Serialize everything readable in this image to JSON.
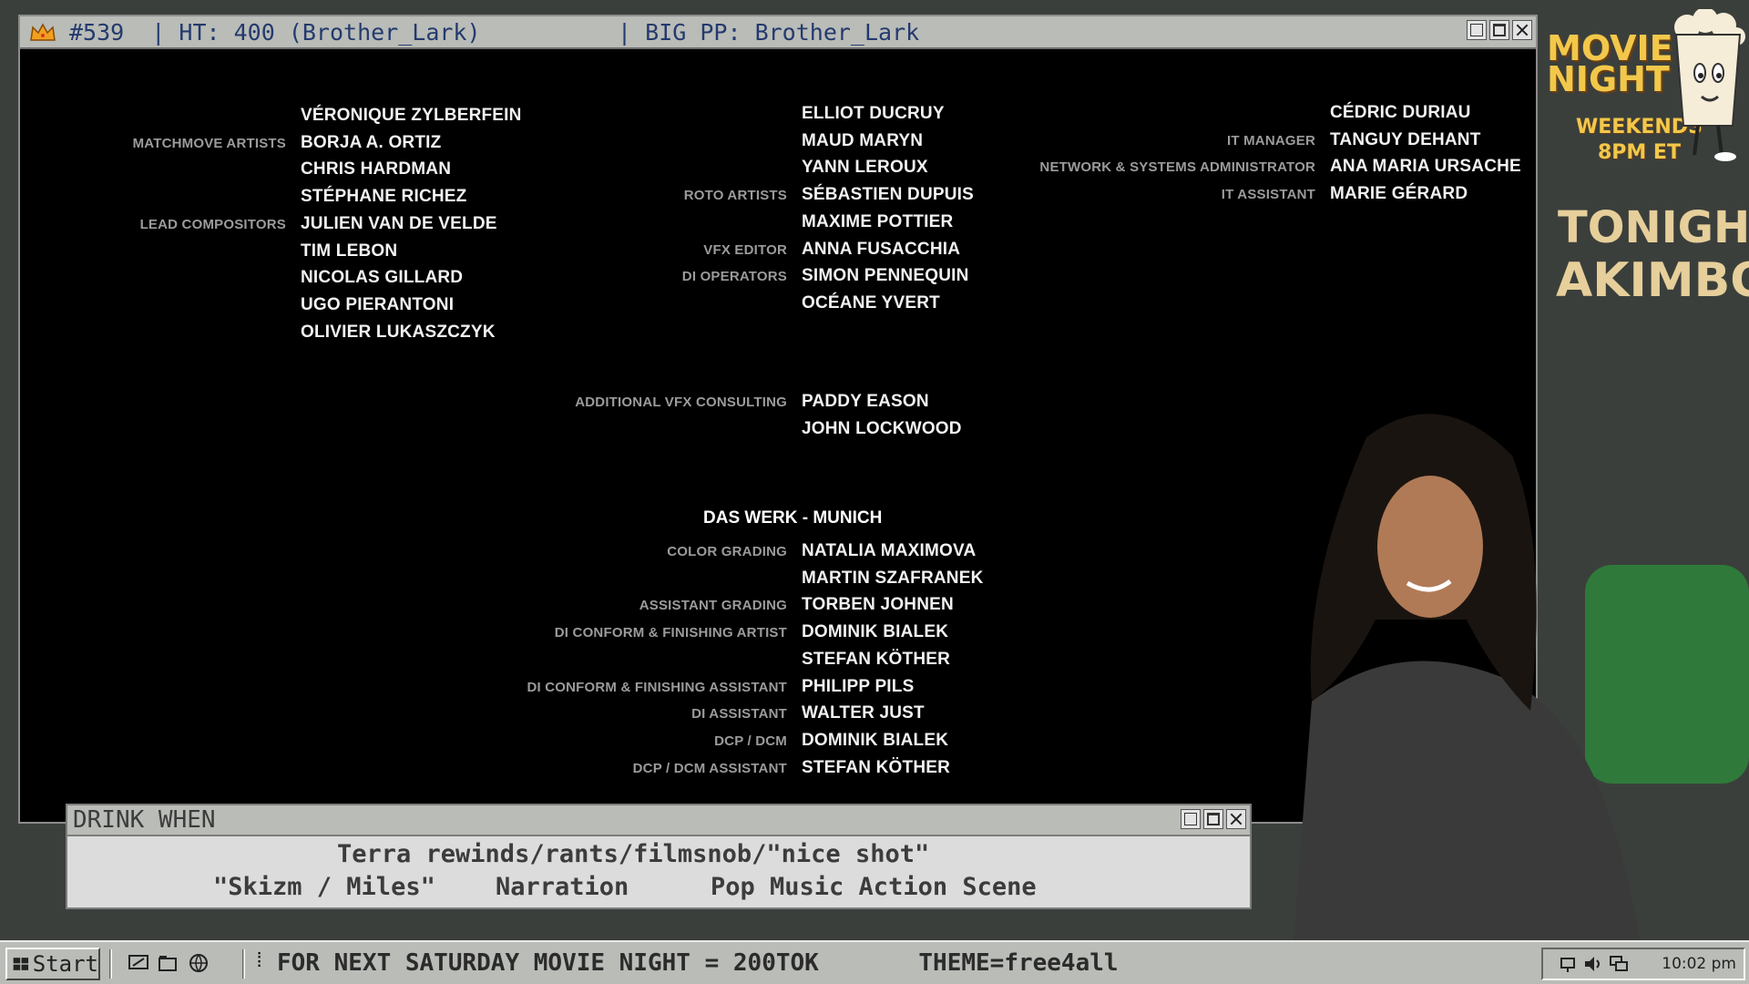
{
  "main_window": {
    "title": "#539  | HT: 400 (Brother_Lark)          | BIG PP: Brother_Lark",
    "icon": "crown-icon",
    "controls": [
      "minimize-icon",
      "maximize-icon",
      "close-icon"
    ]
  },
  "credits": {
    "left": [
      {
        "role": "",
        "name": "VÉRONIQUE ZYLBERFEIN"
      },
      {
        "role": "MATCHMOVE ARTISTS",
        "name": "BORJA A. ORTIZ"
      },
      {
        "role": "",
        "name": "CHRIS HARDMAN"
      },
      {
        "role": "",
        "name": "STÉPHANE RICHEZ"
      },
      {
        "role": "LEAD COMPOSITORS",
        "name": "JULIEN VAN DE VELDE"
      },
      {
        "role": "",
        "name": "TIM LEBON"
      },
      {
        "role": "",
        "name": "NICOLAS GILLARD"
      },
      {
        "role": "",
        "name": "UGO PIERANTONI"
      },
      {
        "role": "",
        "name": "OLIVIER LUKASZCZYK"
      }
    ],
    "middle": [
      {
        "role": "",
        "name": "ELLIOT DUCRUY"
      },
      {
        "role": "",
        "name": "MAUD MARYN"
      },
      {
        "role": "",
        "name": "YANN LEROUX"
      },
      {
        "role": "ROTO ARTISTS",
        "name": "SÉBASTIEN DUPUIS"
      },
      {
        "role": "",
        "name": "MAXIME POTTIER"
      },
      {
        "role": "VFX EDITOR",
        "name": "ANNA FUSACCHIA"
      },
      {
        "role": "DI OPERATORS",
        "name": "SIMON PENNEQUIN"
      },
      {
        "role": "",
        "name": "OCÉANE YVERT"
      }
    ],
    "right": [
      {
        "role": "",
        "name": "CÉDRIC DURIAU"
      },
      {
        "role": "IT MANAGER",
        "name": "TANGUY DEHANT"
      },
      {
        "role": "NETWORK & SYSTEMS ADMINISTRATOR",
        "name": "ANA MARIA URSACHE"
      },
      {
        "role": "IT ASSISTANT",
        "name": "MARIE GÉRARD"
      }
    ],
    "consulting": [
      {
        "role": "ADDITIONAL VFX CONSULTING",
        "name": "PADDY EASON"
      },
      {
        "role": "",
        "name": "JOHN LOCKWOOD"
      }
    ],
    "das_werk_heading": "DAS WERK - MUNICH",
    "das_werk": [
      {
        "role": "COLOR GRADING",
        "name": "NATALIA MAXIMOVA"
      },
      {
        "role": "",
        "name": "MARTIN SZAFRANEK"
      },
      {
        "role": "ASSISTANT GRADING",
        "name": "TORBEN JOHNEN"
      },
      {
        "role": "DI CONFORM & FINISHING ARTIST",
        "name": "DOMINIK BIALEK"
      },
      {
        "role": "",
        "name": "STEFAN KÖTHER"
      },
      {
        "role": "DI CONFORM & FINISHING ASSISTANT",
        "name": "PHILIPP PILS"
      },
      {
        "role": "DI ASSISTANT",
        "name": "WALTER JUST"
      },
      {
        "role": "DCP / DCM",
        "name": "DOMINIK BIALEK"
      },
      {
        "role": "DCP / DCM ASSISTANT",
        "name": "STEFAN KÖTHER"
      }
    ]
  },
  "drink_window": {
    "title": "DRINK WHEN",
    "line1": "Terra rewinds/rants/filmsnob/\"nice shot\"",
    "line2_items": [
      "\"Skizm / Miles\"",
      "Narration",
      "Pop Music Action Scene"
    ]
  },
  "sidebar": {
    "logo_line1": "MOVIE",
    "logo_line2": "NIGHT",
    "logo_sub1": "WEEKENDS",
    "logo_sub2": "8PM ET",
    "tonight_label": "TONIGHT:",
    "tonight_title": "AKIMBO"
  },
  "taskbar": {
    "start_label": "Start",
    "ticker": "FOR NEXT SATURDAY MOVIE NIGHT = 200TOK       THEME=free4all",
    "clock": "10:02 pm",
    "quick_launch": [
      "desktop-icon",
      "explorer-icon",
      "browser-icon"
    ]
  },
  "colors": {
    "titlebar_text": "#243a6e",
    "role_text": "#9b9b9b",
    "name_text": "#f2f2f2",
    "logo_gold": "#f2c84b"
  }
}
